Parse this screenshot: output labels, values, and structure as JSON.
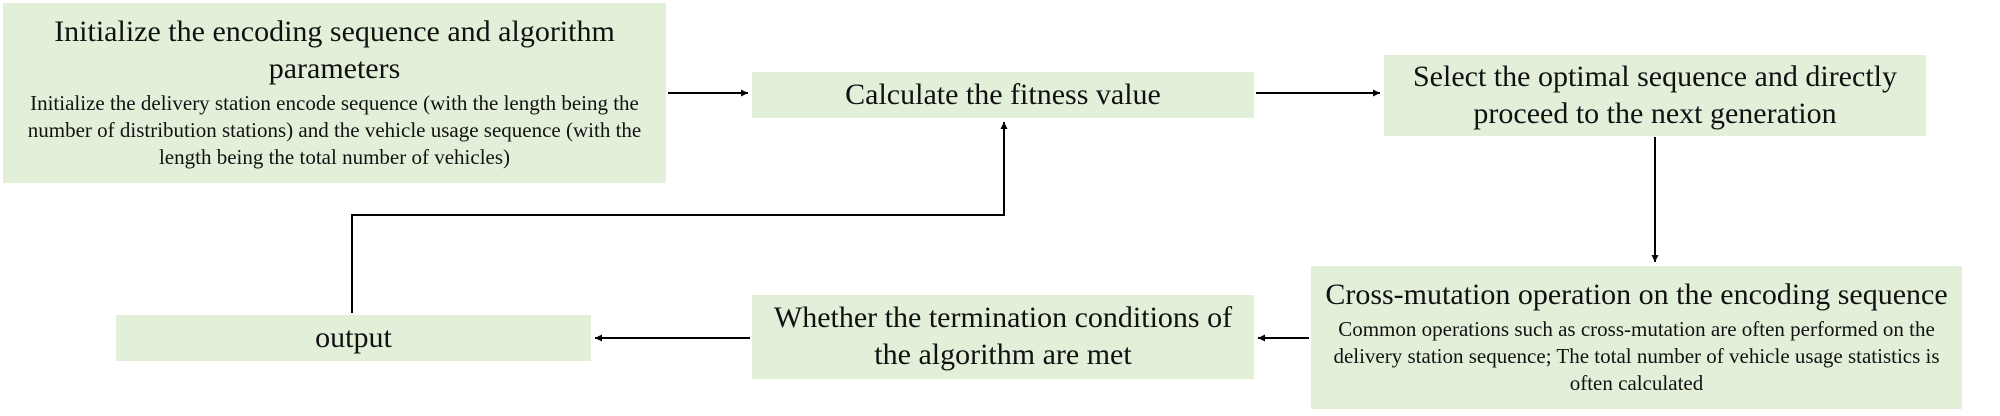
{
  "diagram": {
    "nodes": {
      "init": {
        "title": "Initialize the encoding sequence and algorithm parameters",
        "description": "Initialize the delivery station encode sequence (with the length being the number of distribution stations) and the vehicle usage sequence (with the length being the total number of vehicles)"
      },
      "fitness": {
        "title": "Calculate the fitness value"
      },
      "select": {
        "title": "Select the optimal sequence and directly proceed to the next generation"
      },
      "cross": {
        "title": "Cross-mutation operation on the encoding sequence",
        "description": "Common operations such as cross-mutation are often performed on the delivery station sequence; The total number of vehicle usage statistics is often calculated"
      },
      "termination": {
        "title": "Whether the termination conditions of the algorithm are met"
      },
      "output": {
        "title": "output"
      }
    },
    "edges": [
      {
        "from": "init",
        "to": "fitness"
      },
      {
        "from": "fitness",
        "to": "select"
      },
      {
        "from": "select",
        "to": "cross"
      },
      {
        "from": "cross",
        "to": "termination"
      },
      {
        "from": "termination",
        "to": "output"
      },
      {
        "from": "output",
        "to": "fitness"
      }
    ],
    "colors": {
      "box_fill": "#e2efd9",
      "line": "#000000"
    }
  }
}
